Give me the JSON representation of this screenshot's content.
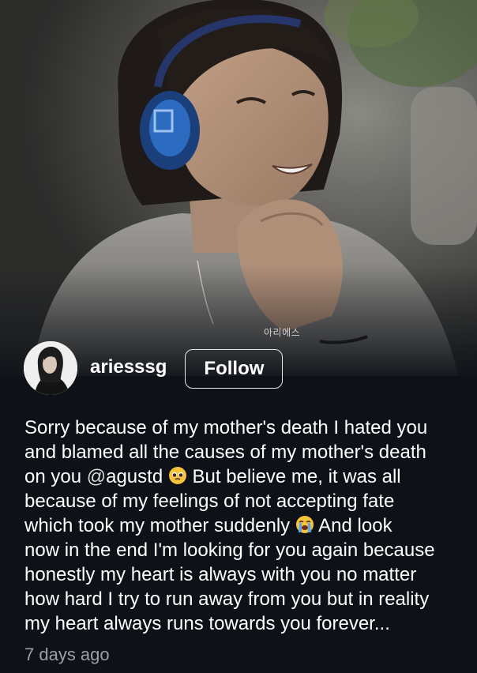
{
  "photo": {
    "watermark": "아리에스"
  },
  "author": {
    "username": "ariesssg",
    "avatar_icon": "profile-photo-avatar"
  },
  "follow_button": {
    "label": "Follow"
  },
  "caption": {
    "line1": "Sorry because of my mother's death I hated you",
    "line2": "and blamed all the causes of my mother's death",
    "line3_pre": "on you ",
    "line3_mention_prefix": "@",
    "line3_mention": "agustd",
    "line3_post": " But believe me, it was all",
    "line4": "because of my feelings of not accepting fate",
    "line5_pre": "which took my mother suddenly ",
    "line5_post": " And look",
    "line6": "now in the end I'm looking for you again because",
    "line7": "honestly my heart is always with you no matter",
    "line8": "how hard I try to run away from you but in reality",
    "line9": "my heart always runs towards you forever..."
  },
  "timestamp": "7 days ago",
  "colors": {
    "background": "#0e1218",
    "text": "#ffffff",
    "muted": "#9aa0a6",
    "emoji_yellow": "#f7c33b"
  }
}
